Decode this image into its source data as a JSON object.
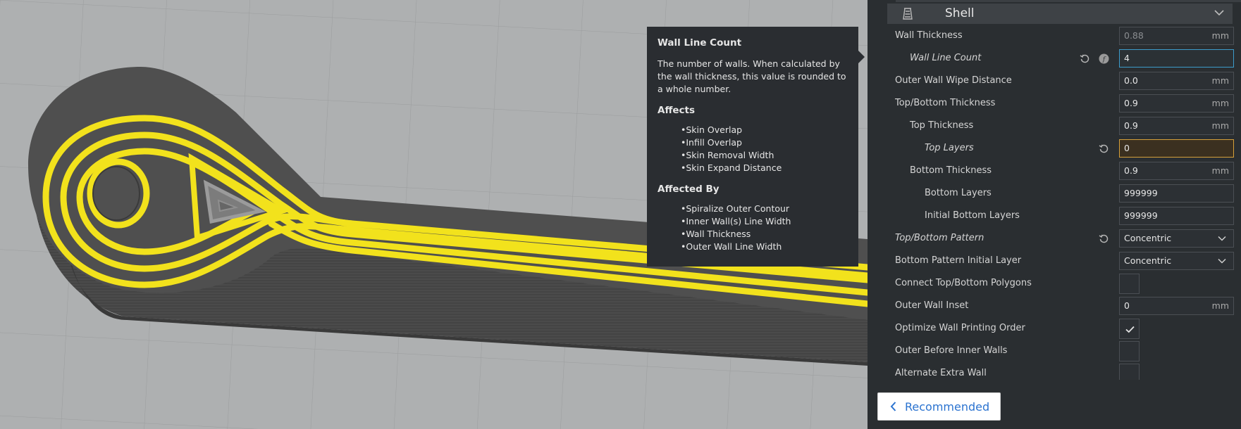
{
  "section": {
    "title": "Shell"
  },
  "tooltip": {
    "title": "Wall Line Count",
    "description": "The number of walls. When calculated by the wall thickness, this value is rounded to a whole number.",
    "affects_heading": "Affects",
    "affects": [
      "Skin Overlap",
      "Infill Overlap",
      "Skin Removal Width",
      "Skin Expand Distance"
    ],
    "affected_by_heading": "Affected By",
    "affected_by": [
      "Spiralize Outer Contour",
      "Inner Wall(s) Line Width",
      "Wall Thickness",
      "Outer Wall Line Width"
    ]
  },
  "settings": {
    "wall_thickness": {
      "label": "Wall Thickness",
      "value": "0.88",
      "unit": "mm"
    },
    "wall_line_count": {
      "label": "Wall Line Count",
      "value": "4"
    },
    "outer_wall_wipe": {
      "label": "Outer Wall Wipe Distance",
      "value": "0.0",
      "unit": "mm"
    },
    "top_bottom_thickness": {
      "label": "Top/Bottom Thickness",
      "value": "0.9",
      "unit": "mm"
    },
    "top_thickness": {
      "label": "Top Thickness",
      "value": "0.9",
      "unit": "mm"
    },
    "top_layers": {
      "label": "Top Layers",
      "value": "0"
    },
    "bottom_thickness": {
      "label": "Bottom Thickness",
      "value": "0.9",
      "unit": "mm"
    },
    "bottom_layers": {
      "label": "Bottom Layers",
      "value": "999999"
    },
    "initial_bottom_layers": {
      "label": "Initial Bottom Layers",
      "value": "999999"
    },
    "top_bottom_pattern": {
      "label": "Top/Bottom Pattern",
      "value": "Concentric"
    },
    "bottom_pattern_initial": {
      "label": "Bottom Pattern Initial Layer",
      "value": "Concentric"
    },
    "connect_polygons": {
      "label": "Connect Top/Bottom Polygons",
      "checked": false
    },
    "outer_wall_inset": {
      "label": "Outer Wall Inset",
      "value": "0",
      "unit": "mm"
    },
    "optimize_wall_order": {
      "label": "Optimize Wall Printing Order",
      "checked": true
    },
    "outer_before_inner": {
      "label": "Outer Before Inner Walls",
      "checked": false
    },
    "alternate_extra_wall": {
      "label": "Alternate Extra Wall",
      "checked": false
    }
  },
  "footer": {
    "recommended_label": "Recommended"
  },
  "colors": {
    "accent_blue": "#3d9ccb",
    "warning_orange": "#d6a03a",
    "extrusion_yellow": "#f2e21c",
    "panel_bg": "#2a2e31"
  },
  "icons": [
    "shell-icon",
    "chevron-up-icon",
    "reset-icon",
    "formula-icon",
    "chevron-down-icon",
    "checkmark-icon",
    "chevron-left-icon"
  ]
}
